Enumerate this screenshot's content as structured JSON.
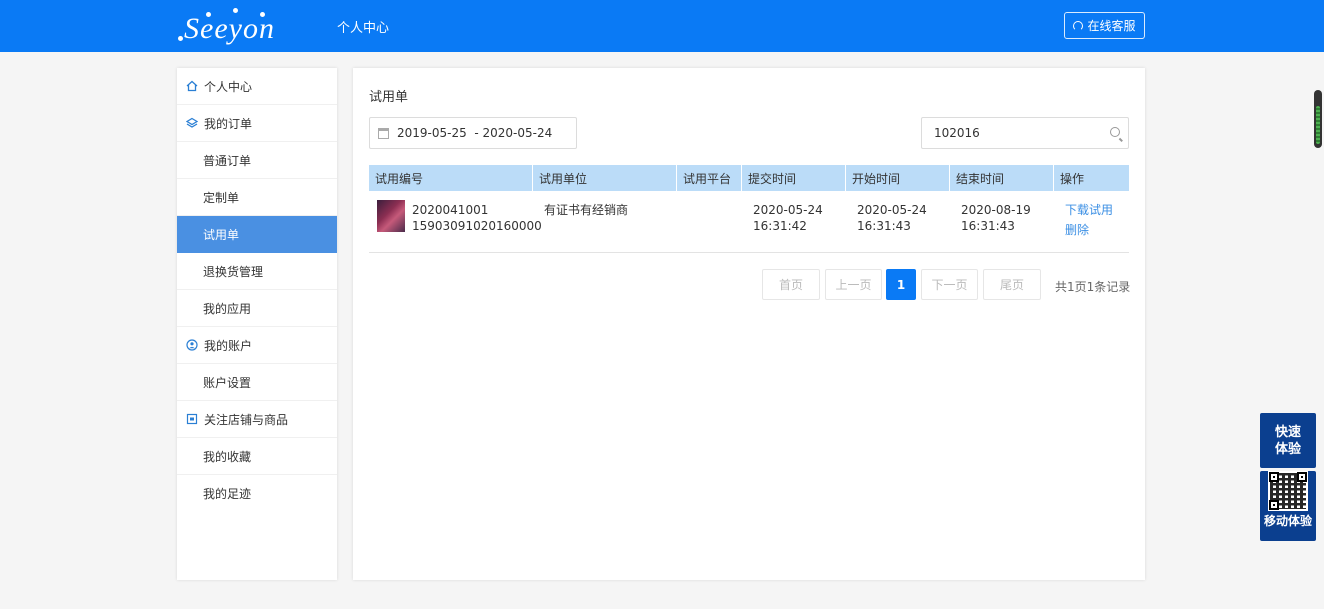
{
  "header": {
    "logo_text": "Seeyon",
    "title": "个人中心",
    "service_label": "在线客服"
  },
  "sidebar": {
    "items": [
      {
        "label": "个人中心",
        "icon": "home-icon"
      },
      {
        "label": "我的订单",
        "icon": "layers-icon"
      },
      {
        "label": "普通订单"
      },
      {
        "label": "定制单"
      },
      {
        "label": "试用单",
        "active": true
      },
      {
        "label": "退换货管理"
      },
      {
        "label": "我的应用"
      },
      {
        "label": "我的账户",
        "icon": "account-icon"
      },
      {
        "label": "账户设置"
      },
      {
        "label": "关注店铺与商品",
        "icon": "store-icon"
      },
      {
        "label": "我的收藏"
      },
      {
        "label": "我的足迹"
      }
    ]
  },
  "main": {
    "title": "试用单",
    "date_range": "2019-05-25  - 2020-05-24",
    "search_value": "102016"
  },
  "table": {
    "columns": [
      "试用编号",
      "试用单位",
      "试用平台",
      "提交时间",
      "开始时间",
      "结束时间",
      "操作"
    ],
    "rows": [
      {
        "code_line1": "2020041001",
        "code_line2": "15903091020160000",
        "unit": "有证书有经销商",
        "platform": "",
        "submit_date": "2020-05-24",
        "submit_time": "16:31:42",
        "start_date": "2020-05-24",
        "start_time": "16:31:43",
        "end_date": "2020-08-19",
        "end_time": "16:31:43",
        "action_download": "下载试用",
        "action_delete": "删除"
      }
    ]
  },
  "pagination": {
    "first": "首页",
    "prev": "上一页",
    "current": "1",
    "next": "下一页",
    "last": "尾页",
    "info": "共1页1条记录"
  },
  "float": {
    "quick_line1": "快速",
    "quick_line2": "体验",
    "mobile_label": "移动体验"
  },
  "colors": {
    "brand": "#0a7af5",
    "header_row": "#bbdcf8",
    "active_nav": "#4a90e2",
    "link": "#3b8fe4",
    "float_panel": "#0b3f8f"
  }
}
